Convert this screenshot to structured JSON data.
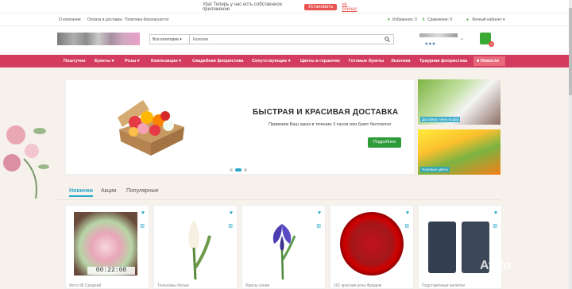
{
  "banner": {
    "message": "Ура! Теперь у нас есть собственное приложение",
    "install": "Установить",
    "dismiss": "не сейчас"
  },
  "topbar": {
    "links": [
      "О компании",
      "Оплата и доставка",
      "Политика безопасности"
    ],
    "favorites": "Избранное: 0",
    "compare": "Сравнение: 0",
    "account": "Личный кабинет ▾"
  },
  "search": {
    "category": "Все категории",
    "placeholder": "Капонки"
  },
  "cart": {
    "count": "0"
  },
  "nav": {
    "items": [
      "Поштучно",
      "Букеты ▾",
      "Розы ▾",
      "Композиции ▾",
      "Свадебная флористика",
      "Сопутствующие ▾",
      "Цветы в горшочке",
      "Готовые букеты",
      "Экзотика",
      "Траурная флористика"
    ],
    "news": "Новости"
  },
  "slider": {
    "title": "БЫСТРАЯ И КРАСИВАЯ ДОСТАВКА",
    "subtitle": "Привезем Ваш заказ в течении 3 часов или букет бесплатно",
    "button": "Подробнее"
  },
  "side_banners": [
    "Доставка точно в срок",
    "Полевые цветы"
  ],
  "tabs": [
    "Новинки",
    "Акции",
    "Популярные"
  ],
  "products": [
    "Фото 98 Средний",
    "Тюльпаны белые",
    "Ирисы синие",
    "101 красная роза Фридом",
    "Подставочные жилетки"
  ],
  "timer": "00:22:08",
  "watermark": "Avito"
}
